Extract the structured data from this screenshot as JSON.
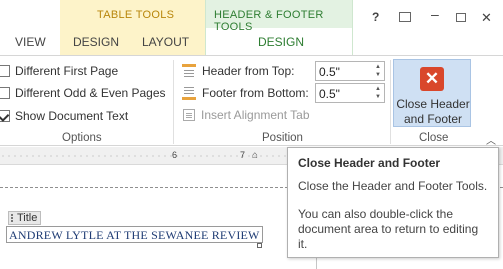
{
  "tabs": {
    "view": "VIEW",
    "table_tools_title": "TABLE TOOLS",
    "design_table": "DESIGN",
    "layout": "LAYOUT",
    "header_footer_tools_title": "HEADER & FOOTER TOOLS",
    "design_hf": "DESIGN"
  },
  "window_controls": {
    "help": "?",
    "minimize": "–",
    "close": "✕"
  },
  "options": {
    "different_first_page": "Different First Page",
    "different_odd_even": "Different Odd & Even Pages",
    "show_document_text": "Show Document Text",
    "different_first_page_checked": false,
    "different_odd_even_checked": false,
    "show_document_text_checked": true,
    "group_label": "Options"
  },
  "position": {
    "header_from_top_label": "Header from Top:",
    "header_from_top_value": "0.5\"",
    "footer_from_bottom_label": "Footer from Bottom:",
    "footer_from_bottom_value": "0.5\"",
    "insert_alignment_tab": "Insert Alignment Tab",
    "group_label": "Position"
  },
  "close_group": {
    "button_label": "Close Header and Footer",
    "group_label": "Close"
  },
  "ruler": {
    "num_6": "6",
    "num_7": "7"
  },
  "document": {
    "title_tag": "Title",
    "title_text": "ANDREW LYTLE AT THE SEWANEE REVIEW"
  },
  "tooltip": {
    "title": "Close Header and Footer",
    "description": "Close the Header and Footer Tools.",
    "extra": "You can also double-click the document area to return to editing it."
  },
  "colors": {
    "table_tools_bg": "#fdf3c9",
    "hf_tools_accent": "#2e7d32",
    "close_icon_red": "#d9472b",
    "title_text_blue": "#1f3c74"
  }
}
